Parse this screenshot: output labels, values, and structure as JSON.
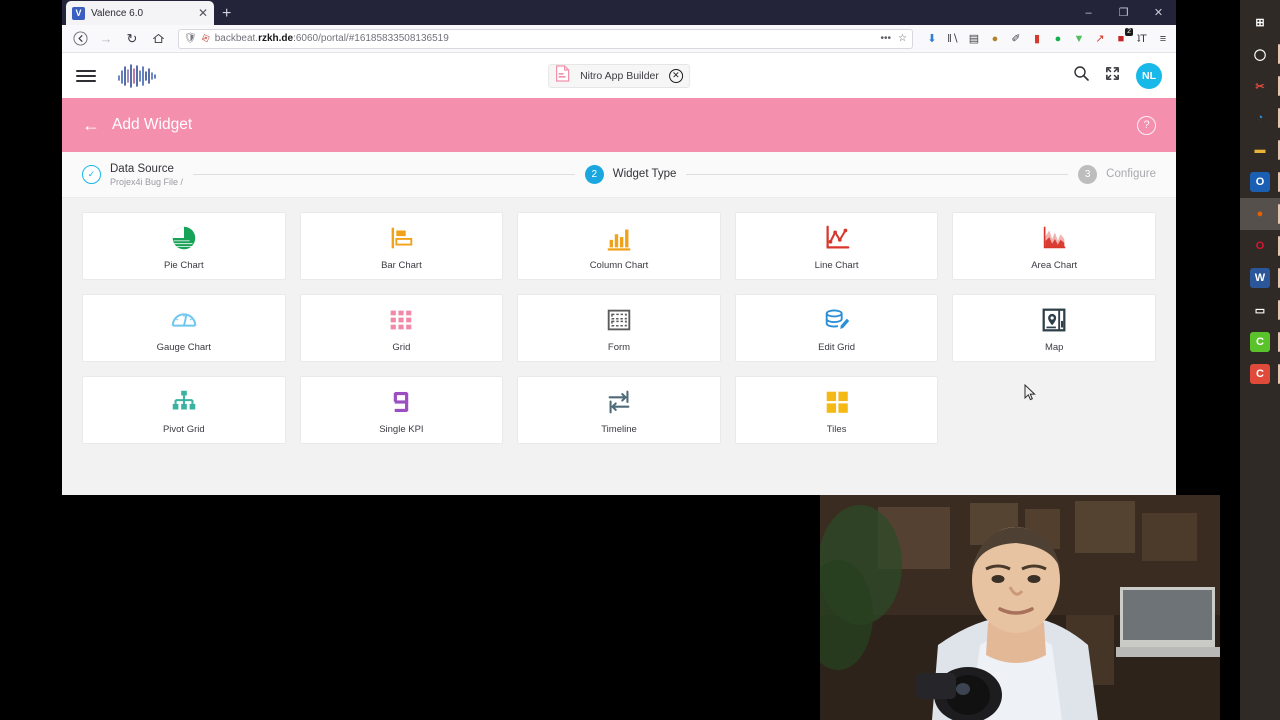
{
  "browser": {
    "tab": {
      "title": "Valence 6.0",
      "favicon_letter": "V",
      "close_icon": "close-icon"
    },
    "new_tab_label": "+",
    "window_controls": {
      "minimize": "–",
      "restore": "❐",
      "close": "✕"
    },
    "nav": {
      "back": "←",
      "forward": "→",
      "reload": "↻",
      "home": "⌂"
    },
    "url": {
      "prefix": "backbeat.",
      "domain": "rzkh.de",
      "suffix": ":6060/portal/#16185833508136519"
    },
    "url_actions": {
      "more": "•••",
      "bookmark": "☆"
    },
    "extensions": [
      {
        "name": "downloads-icon",
        "glyph": "⬇",
        "color": "#2f7fd1"
      },
      {
        "name": "library-icon",
        "glyph": "‖∖",
        "color": "#3c3c42"
      },
      {
        "name": "sidebar-icon",
        "glyph": "▤",
        "color": "#3c3c42"
      },
      {
        "name": "cookie-icon",
        "glyph": "●",
        "color": "#b08330"
      },
      {
        "name": "eyedropper-icon",
        "glyph": "✐",
        "color": "#3c3c42"
      },
      {
        "name": "recorder-icon",
        "glyph": "▮",
        "color": "#d23b2e"
      },
      {
        "name": "circle-green-icon",
        "glyph": "●",
        "color": "#12b04a"
      },
      {
        "name": "shield-icon",
        "glyph": "▼",
        "color": "#4fbf5f"
      },
      {
        "name": "pointer-red-icon",
        "glyph": "↗",
        "color": "#d4352c"
      },
      {
        "name": "extension-badge-icon",
        "glyph": "■",
        "color": "#c62828",
        "badge": "2"
      },
      {
        "name": "translate-icon",
        "glyph": "ʇT",
        "color": "#3c3c42"
      },
      {
        "name": "menu-icon",
        "glyph": "≡",
        "color": "#3c3c42"
      }
    ]
  },
  "app": {
    "menu_icon": "hamburger-menu-icon",
    "logo_name": "valence-waveform-logo",
    "chip": {
      "icon": "pdf-document-icon",
      "label": "Nitro App Builder",
      "close": "✕"
    },
    "search_icon": "search-icon",
    "fullscreen_icon": "fullscreen-icon",
    "avatar_initials": "NL",
    "avatar_color": "#18b8e8"
  },
  "page_header": {
    "back_arrow": "←",
    "title": "Add Widget",
    "help_icon": "?",
    "bar_color": "#f490ad"
  },
  "stepper": {
    "steps": [
      {
        "num": "✓",
        "label": "Data Source",
        "sub": "Projex4i Bug File /",
        "state": "done"
      },
      {
        "num": "2",
        "label": "Widget Type",
        "sub": "",
        "state": "active"
      },
      {
        "num": "3",
        "label": "Configure",
        "sub": "",
        "state": "todo"
      }
    ]
  },
  "widgets": [
    {
      "label": "Pie Chart",
      "icon": "pie-chart-icon",
      "color": "#17a357"
    },
    {
      "label": "Bar Chart",
      "icon": "bar-chart-icon",
      "color": "#f0a21a"
    },
    {
      "label": "Column Chart",
      "icon": "column-chart-icon",
      "color": "#f0a21a"
    },
    {
      "label": "Line Chart",
      "icon": "line-chart-icon",
      "color": "#d8382c"
    },
    {
      "label": "Area Chart",
      "icon": "area-chart-icon",
      "color": "#d8382c"
    },
    {
      "label": "Gauge Chart",
      "icon": "gauge-chart-icon",
      "color": "#6ec6ef"
    },
    {
      "label": "Grid",
      "icon": "grid-icon",
      "color": "#f287a8"
    },
    {
      "label": "Form",
      "icon": "form-icon",
      "color": "#5b5b5b"
    },
    {
      "label": "Edit Grid",
      "icon": "edit-grid-icon",
      "color": "#2b8fd6"
    },
    {
      "label": "Map",
      "icon": "map-pin-icon",
      "color": "#2e3f4a"
    },
    {
      "label": "Pivot Grid",
      "icon": "pivot-grid-icon",
      "color": "#3ab2a0"
    },
    {
      "label": "Single KPI",
      "icon": "single-kpi-icon",
      "color": "#9b4fc0"
    },
    {
      "label": "Timeline",
      "icon": "timeline-icon",
      "color": "#4f6b78"
    },
    {
      "label": "Tiles",
      "icon": "tiles-icon",
      "color": "#f5b916"
    }
  ],
  "taskbar": [
    {
      "name": "start-button-icon",
      "glyph": "⊞",
      "bg": "transparent",
      "fg": "#ffffff",
      "active": false
    },
    {
      "name": "cortana-search-icon",
      "glyph": "◯",
      "bg": "transparent",
      "fg": "#ffffff",
      "active": false
    },
    {
      "name": "snip-sketch-icon",
      "glyph": "✂",
      "bg": "transparent",
      "fg": "#e04a3a",
      "active": false
    },
    {
      "name": "microsoft-edge-icon",
      "glyph": "◔",
      "bg": "transparent",
      "fg": "#2b8fd6",
      "active": false
    },
    {
      "name": "file-explorer-icon",
      "glyph": "▬",
      "bg": "transparent",
      "fg": "#e8b339",
      "active": false
    },
    {
      "name": "outlook-icon",
      "glyph": "O",
      "bg": "#1a5fb4",
      "fg": "#ffffff",
      "active": false
    },
    {
      "name": "firefox-icon",
      "glyph": "●",
      "bg": "transparent",
      "fg": "#e66000",
      "active": true
    },
    {
      "name": "opera-icon",
      "glyph": "O",
      "bg": "transparent",
      "fg": "#d8152f",
      "active": false
    },
    {
      "name": "word-icon",
      "glyph": "W",
      "bg": "#2b579a",
      "fg": "#ffffff",
      "active": false
    },
    {
      "name": "remote-desktop-icon",
      "glyph": "▭",
      "bg": "transparent",
      "fg": "#ffffff",
      "active": false
    },
    {
      "name": "app-green-c-icon",
      "glyph": "C",
      "bg": "#5ac22b",
      "fg": "#ffffff",
      "active": false
    },
    {
      "name": "app-red-c-icon",
      "glyph": "C",
      "bg": "#e04a3a",
      "fg": "#ffffff",
      "active": false
    }
  ]
}
